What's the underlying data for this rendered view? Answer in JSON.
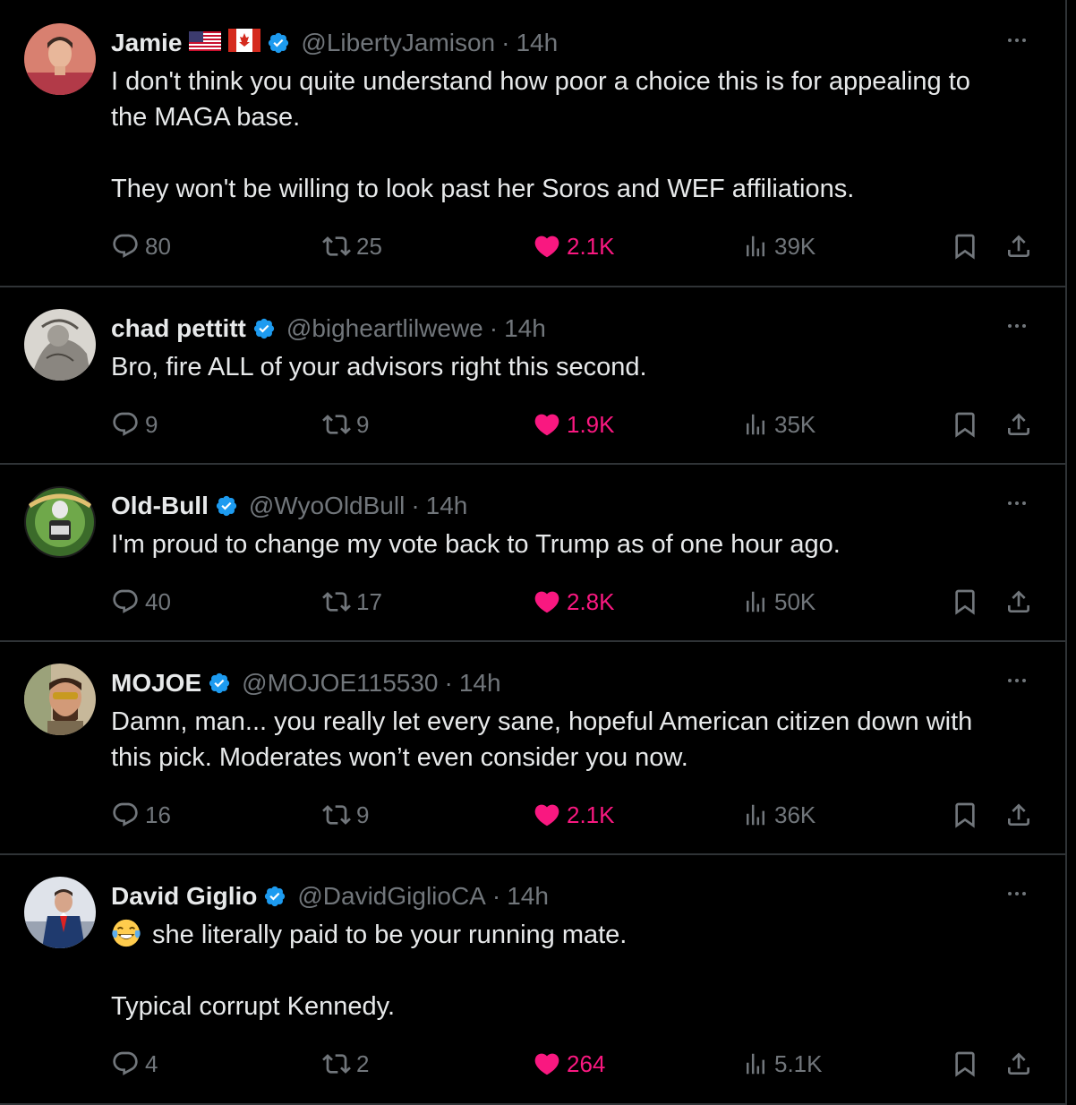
{
  "tweets": [
    {
      "name": "Jamie",
      "handle": "@LibertyJamison",
      "dot": "·",
      "time": "14h",
      "flags": [
        "us-flag-icon",
        "canada-flag-icon"
      ],
      "text": "I don't think you quite understand how poor a choice this is for appealing to\nthe MAGA base.\n\nThey won't be willing to look past her Soros and WEF affiliations.",
      "replies": "80",
      "reposts": "25",
      "likes": "2.1K",
      "views": "39K"
    },
    {
      "name": "chad pettitt",
      "handle": "@bigheartlilwewe",
      "dot": "·",
      "time": "14h",
      "text": "Bro, fire ALL of your advisors right this second.",
      "replies": "9",
      "reposts": "9",
      "likes": "1.9K",
      "views": "35K"
    },
    {
      "name": "Old-Bull",
      "handle": "@WyoOldBull",
      "dot": "·",
      "time": "14h",
      "text": "I'm proud to change my vote back to Trump as of one hour ago.",
      "replies": "40",
      "reposts": "17",
      "likes": "2.8K",
      "views": "50K"
    },
    {
      "name": "MOJOE",
      "handle": "@MOJOE115530",
      "dot": "·",
      "time": "14h",
      "text": "Damn, man... you really let every sane, hopeful American citizen down with\nthis pick.  Moderates won’t even consider you now.",
      "replies": "16",
      "reposts": "9",
      "likes": "2.1K",
      "views": "36K"
    },
    {
      "name": "David Giglio",
      "handle": "@DavidGiglioCA",
      "dot": "·",
      "time": "14h",
      "emoji": "face-with-tears-of-joy-icon",
      "text_first": "she literally paid to be your running mate.",
      "text_rest": "\nTypical corrupt Kennedy.",
      "replies": "4",
      "reposts": "2",
      "likes": "264",
      "views": "5.1K"
    }
  ],
  "colors": {
    "background": "#000000",
    "text": "#e7e9ea",
    "secondary": "#71767b",
    "like": "#f91880",
    "verified": "#1d9bf0",
    "divider": "#2f3336"
  }
}
